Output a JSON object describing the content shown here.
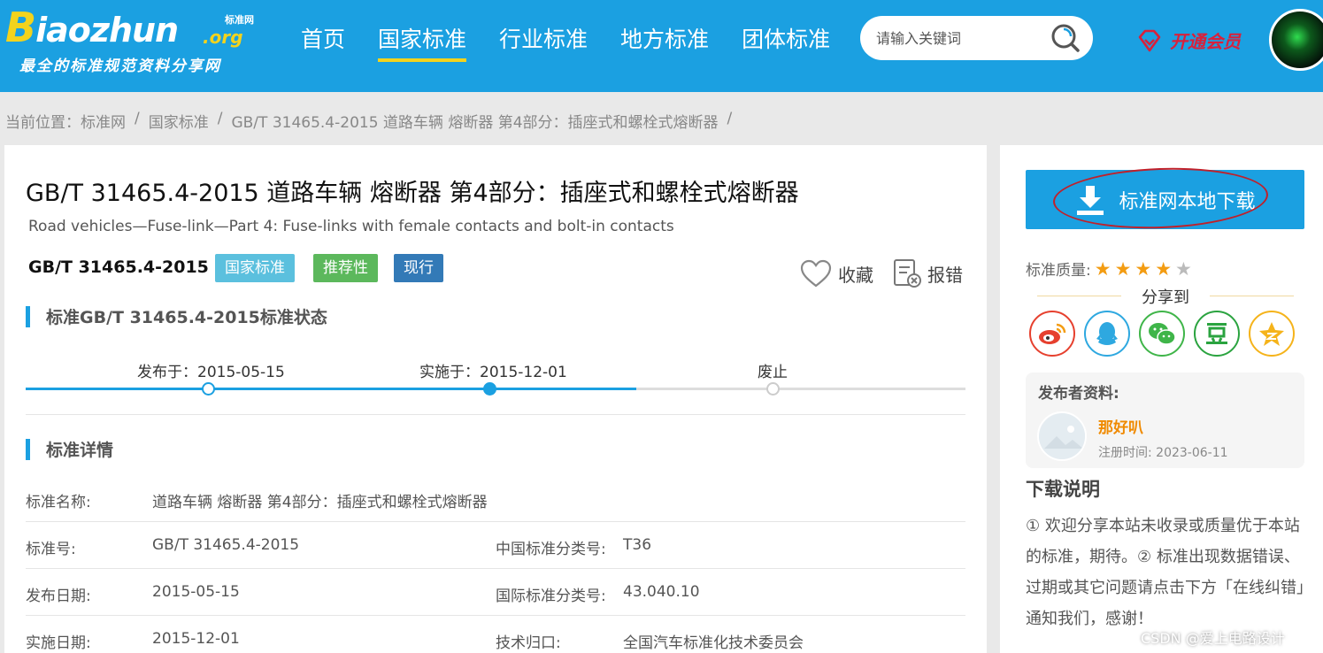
{
  "header": {
    "logo": {
      "wordmark": "Biaozhun",
      "org": ".org",
      "small_label": "标准网",
      "slogan": "最全的标准规范资料分享网"
    },
    "nav": [
      "首页",
      "国家标准",
      "行业标准",
      "地方标准",
      "团体标准"
    ],
    "active_nav": "国家标准",
    "search": {
      "placeholder": "请输入关键词"
    },
    "vip_label": "开通会员"
  },
  "breadcrumb": {
    "prefix": "当前位置：",
    "items": [
      "标准网",
      "国家标准",
      "GB/T 31465.4-2015 道路车辆 熔断器 第4部分：插座式和螺栓式熔断器"
    ],
    "sep": "/"
  },
  "standard": {
    "title": "GB/T 31465.4-2015 道路车辆 熔断器 第4部分：插座式和螺栓式熔断器",
    "subtitle_en": "Road vehicles—Fuse-link—Part 4: Fuse-links with female contacts and bolt-in contacts",
    "code": "GB/T 31465.4-2015",
    "tags": [
      "国家标准",
      "推荐性",
      "现行"
    ],
    "favorite_label": "收藏",
    "report_label": "报错"
  },
  "status": {
    "heading": "标准GB/T 31465.4-2015标准状态",
    "publish_label": "发布于：2015-05-15",
    "implement_label": "实施于：2015-12-01",
    "abolish_label": "废止"
  },
  "details": {
    "heading": "标准详情",
    "rows": [
      {
        "k": "标准名称:",
        "v": "道路车辆 熔断器 第4部分：插座式和螺栓式熔断器",
        "k2": "",
        "v2": ""
      },
      {
        "k": "标准号:",
        "v": "GB/T 31465.4-2015",
        "k2": "中国标准分类号:",
        "v2": "T36"
      },
      {
        "k": "发布日期:",
        "v": "2015-05-15",
        "k2": "国际标准分类号:",
        "v2": "43.040.10"
      },
      {
        "k": "实施日期:",
        "v": "2015-12-01",
        "k2": "技术归口:",
        "v2": "全国汽车标准化技术委员会"
      }
    ]
  },
  "sidebar": {
    "download_label": "标准网本地下载",
    "quality_label": "标准质量:",
    "rating": 4,
    "rating_max": 5,
    "share_label": "分享到",
    "share_icons": [
      "weibo-icon",
      "qq-icon",
      "wechat-icon",
      "douban-icon",
      "qzone-icon"
    ],
    "publisher": {
      "heading": "发布者资料:",
      "name": "那好叭",
      "registered": "注册时间: 2023-06-11"
    },
    "download_note": {
      "heading": "下载说明",
      "text": "① 欢迎分享本站未收录或质量优于本站的标准，期待。② 标准出现数据错误、过期或其它问题请点击下方「在线纠错」通知我们，感谢！"
    }
  },
  "watermark": "CSDN @爱上电路设计",
  "colors": {
    "primary": "#1ba0e1",
    "accent_yellow": "#f3d31d",
    "vip_red": "#d9203b",
    "tag_blue": "#5bc0de",
    "tag_green": "#5cb85c",
    "tag_dark": "#337ab7",
    "star": "#f39c12"
  }
}
